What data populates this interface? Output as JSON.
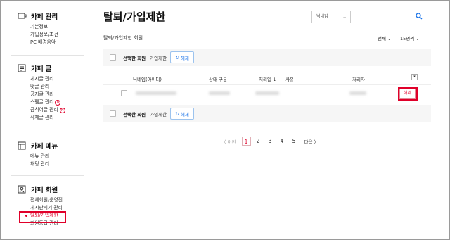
{
  "sidebar": {
    "sections": [
      {
        "icon": "cafe-cup-icon",
        "title": "카페 관리",
        "items": [
          {
            "label": "기본정보"
          },
          {
            "label": "가입정보/조건"
          },
          {
            "label": "PC 배경음악"
          }
        ]
      },
      {
        "icon": "post-icon",
        "title": "카페 글",
        "items": [
          {
            "label": "게시글 관리"
          },
          {
            "label": "댓글 관리"
          },
          {
            "label": "공지글 관리"
          },
          {
            "label": "스팸글 관리",
            "badge": "N"
          },
          {
            "label": "금칙어글 관리",
            "badge": "N"
          },
          {
            "label": "삭제글 관리"
          }
        ]
      },
      {
        "icon": "menu-icon",
        "title": "카페 메뉴",
        "items": [
          {
            "label": "메뉴 관리"
          },
          {
            "label": "채팅 관리"
          }
        ]
      },
      {
        "icon": "member-icon",
        "title": "카페 회원",
        "items": [
          {
            "label": "전체회원/운영진"
          },
          {
            "label": "게시판지기 관리"
          },
          {
            "label": "탈퇴/가입제한",
            "active": true
          },
          {
            "label": "회원등급 관리"
          }
        ]
      }
    ]
  },
  "main": {
    "title": "탈퇴/가입제한",
    "search": {
      "select_value": "닉네임",
      "placeholder": ""
    },
    "subtitle": "탈퇴/가입제한 회원",
    "filter_all": "전체",
    "per_page": "15명씩",
    "toolbar": {
      "selected_label": "선택한 회원",
      "sub_label": "가입제한",
      "button_label": "해제"
    },
    "table": {
      "headers": [
        "닉네임(아이디)",
        "상태 구분",
        "처리일",
        "사유",
        "처리자"
      ],
      "rows": [
        {
          "nickname": "",
          "status": "",
          "date": "",
          "reason": "",
          "handler": "",
          "action": "해제"
        }
      ]
    },
    "pagination": {
      "prev": "〈 이전",
      "pages": [
        "1",
        "2",
        "3",
        "4",
        "5"
      ],
      "current": "1",
      "next": "다음 〉"
    }
  },
  "colors": {
    "accent_red": "#e0002a",
    "accent_blue": "#1a73e8"
  }
}
